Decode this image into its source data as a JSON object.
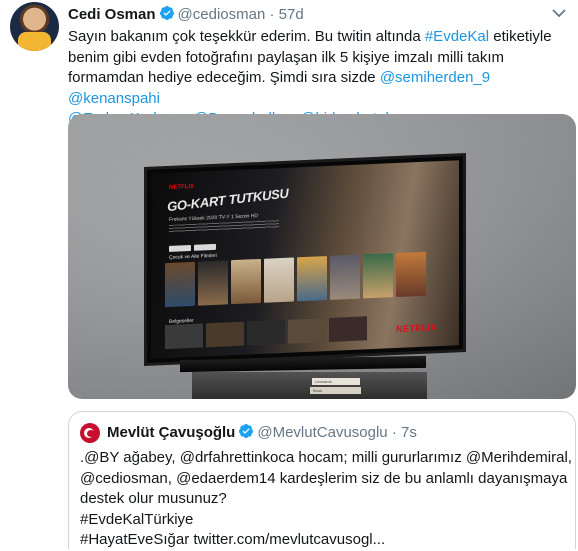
{
  "tweet": {
    "author_name": "Cedi Osman",
    "author_handle": "@cediosman",
    "separator": "·",
    "time": "57d",
    "body": {
      "line1": "Sayın bakanım çok teşekkür ederim. Bu twitin altında ",
      "line1_hashtag": "#EvdeKal",
      "line1_end": " etiketiyle",
      "line2": "benim gibi evden fotoğrafını paylaşan ilk 5 kişiye imzalı milli takım",
      "line3": "formamdan hediye edeceğim. Şimdi sıra sizde ",
      "mention1": "@semiherden_9",
      "mention2": "@kenanspahi",
      "mention3": "@FurkanKorkmaz",
      "mention4": "@Dogusbalbay",
      "mention5": "@birkanbatuk"
    }
  },
  "media": {
    "tv_app_label": "NETFLIX",
    "show_title": "GO-KART TUTKUSU",
    "show_meta": "Frekans Yüksek   2020   TV-Y   1 Sezon   HD",
    "row1_label": "Çocuk ve Aile Filmleri",
    "row2_label": "Belgeseller",
    "netflix_logo": "NETFLIX",
    "book1": "Leonardo",
    "book2": "Book"
  },
  "quoted_tweet": {
    "author_name": "Mevlüt Çavuşoğlu",
    "author_handle": "@MevlutCavusoglu",
    "separator": "·",
    "time": "7s",
    "line1": ".@BY ağabey, @drfahrettinkoca hocam; milli gururlarımız @Merihdemiral,",
    "line2": "@cediosman, @edaerdem14 kardeşlerim siz de bu anlamlı dayanışmaya",
    "line3": "destek olur musunuz?",
    "line4": "#EvdeKalTürkiye",
    "line5": "#HayatEveSığar twitter.com/mevlutcavusogl..."
  },
  "colors": {
    "link": "#1b95e0",
    "text": "#14171a",
    "secondary": "#657786",
    "verified": "#1da1f2",
    "border": "#ccd6dd"
  },
  "icons": [
    "verified-icon",
    "more-icon"
  ]
}
